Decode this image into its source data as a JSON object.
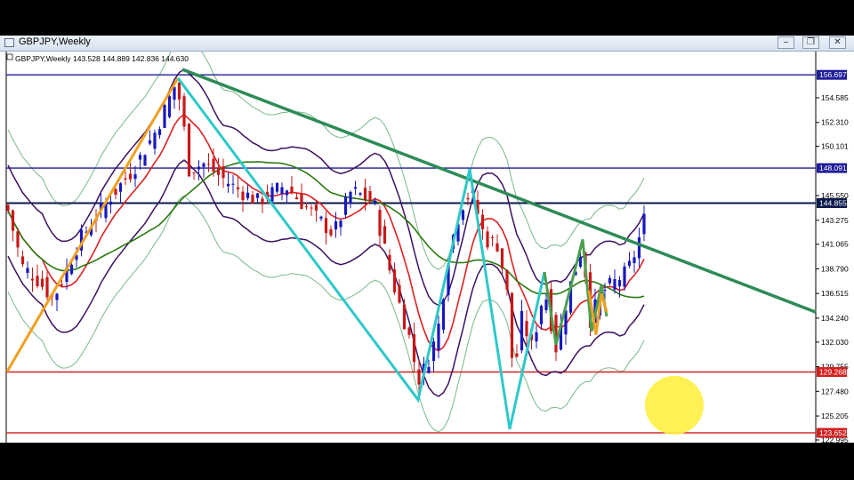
{
  "window": {
    "title": "GBPJPY,Weekly",
    "buttons": [
      "‒",
      "❐",
      "✕"
    ]
  },
  "chart_data": {
    "type": "candlestick",
    "symbol_label": "GBPJPY,Weekly",
    "ohlc_text": "143.528 144.889 142.836 144.630",
    "price_range": [
      122.5,
      158.6
    ],
    "y_ticks": [
      "154.585",
      "152.310",
      "150.101",
      "145.550",
      "143.275",
      "141.065",
      "138.790",
      "136.515",
      "134.240",
      "132.030",
      "129.755",
      "127.480",
      "125.205",
      "122.995"
    ],
    "levels": [
      {
        "value": 156.697,
        "label": "156.697",
        "color": "#1c1c9a"
      },
      {
        "value": 148.091,
        "label": "148.091",
        "color": "#1c1c9a"
      },
      {
        "value": 144.855,
        "label": "144.855",
        "color": "#0a1a4a"
      },
      {
        "value": 129.268,
        "label": "129.268",
        "color": "#d42020"
      },
      {
        "value": 123.652,
        "label": "123.652",
        "color": "#d42020"
      }
    ],
    "colors": {
      "bull": "#1818c0",
      "bear": "#c81818",
      "trendline": "#2e8b57",
      "zigzag_cyan": "#2ec8c8",
      "zigzag_orange": "#f0a020",
      "ma_red": "#e02020",
      "ma_green": "#2a7a10",
      "bands_purple": "#3c1060",
      "bands_outer": "#7ab88a",
      "highlight": "#ffef40"
    }
  }
}
